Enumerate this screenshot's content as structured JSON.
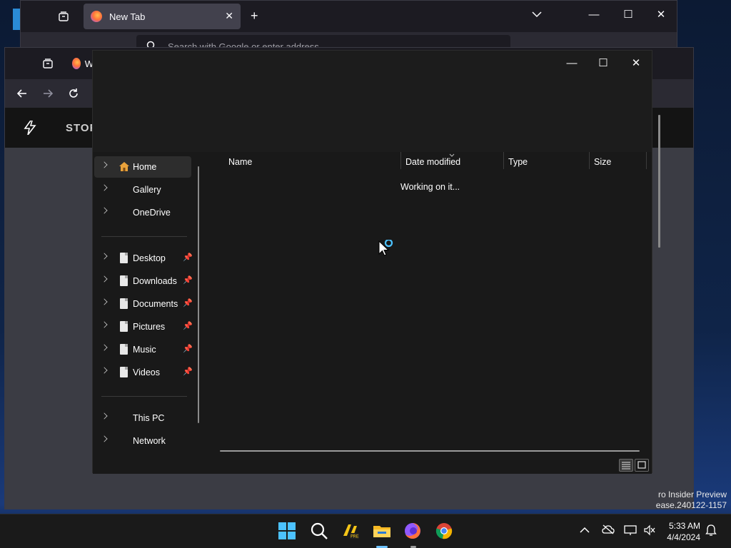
{
  "background_browser": {
    "tab_title": "New Tab",
    "url_placeholder": "Search with Google or enter address"
  },
  "middle_browser": {
    "tab_title_partial": "W",
    "page_header_text": "STOR"
  },
  "explorer": {
    "nav": {
      "top": [
        {
          "label": "Home"
        },
        {
          "label": "Gallery"
        },
        {
          "label": "OneDrive"
        }
      ],
      "quick_access": [
        {
          "label": "Desktop"
        },
        {
          "label": "Downloads"
        },
        {
          "label": "Documents"
        },
        {
          "label": "Pictures"
        },
        {
          "label": "Music"
        },
        {
          "label": "Videos"
        }
      ],
      "bottom": [
        {
          "label": "This PC"
        },
        {
          "label": "Network"
        }
      ]
    },
    "columns": {
      "name": "Name",
      "date_modified": "Date modified",
      "type": "Type",
      "size": "Size"
    },
    "status_message": "Working on it..."
  },
  "desktop": {
    "watermark_line1": "ro Insider Preview",
    "watermark_line2": "ease.240122-1157"
  },
  "taskbar": {
    "time": "5:33 AM",
    "date": "4/4/2024"
  },
  "colors": {
    "accent": "#4cc2ff",
    "explorer_bg": "#191919",
    "taskbar_bg": "#1a1a1a"
  }
}
